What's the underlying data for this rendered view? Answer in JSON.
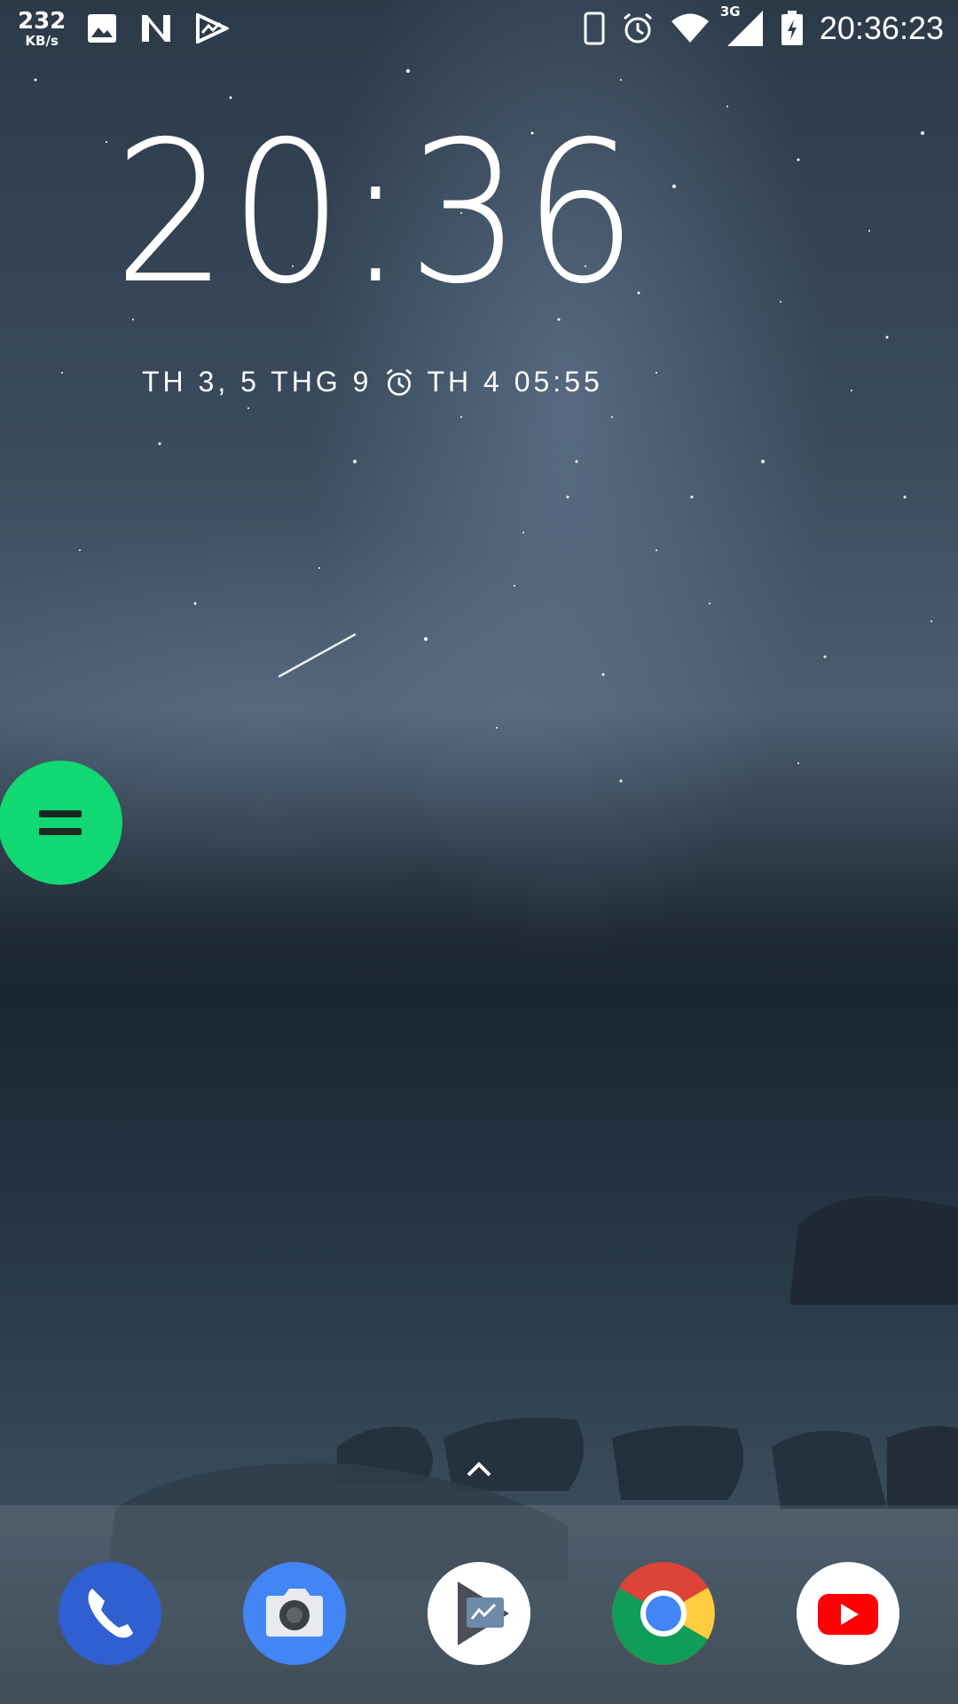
{
  "status_bar": {
    "net_speed_value": "232",
    "net_speed_unit": "KB/s",
    "left_icons": [
      "gallery-icon",
      "n-notification-icon",
      "analytics-icon"
    ],
    "right_icons": [
      "screen-rotation-icon",
      "alarm-icon",
      "wifi-icon",
      "signal-icon",
      "battery-charging-icon"
    ],
    "network_type": "3G",
    "time": "20:36:23"
  },
  "lock_widget": {
    "clock": "20:36",
    "date": "TH 3, 5 THG 9",
    "next_alarm": "TH 4 05:55"
  },
  "floating_bubble": {
    "icon": "equals-icon",
    "color": "#11d873"
  },
  "dock": {
    "apps": [
      {
        "name": "phone-app",
        "icon": "phone-icon",
        "color": "#2f5fd0"
      },
      {
        "name": "camera-app",
        "icon": "camera-icon",
        "color": "#4285f4"
      },
      {
        "name": "files-app",
        "icon": "files-icon",
        "color": "#ffffff"
      },
      {
        "name": "chrome-app",
        "icon": "chrome-icon",
        "color": "#ffffff"
      },
      {
        "name": "youtube-app",
        "icon": "youtube-icon",
        "color": "#ff0000"
      }
    ]
  }
}
